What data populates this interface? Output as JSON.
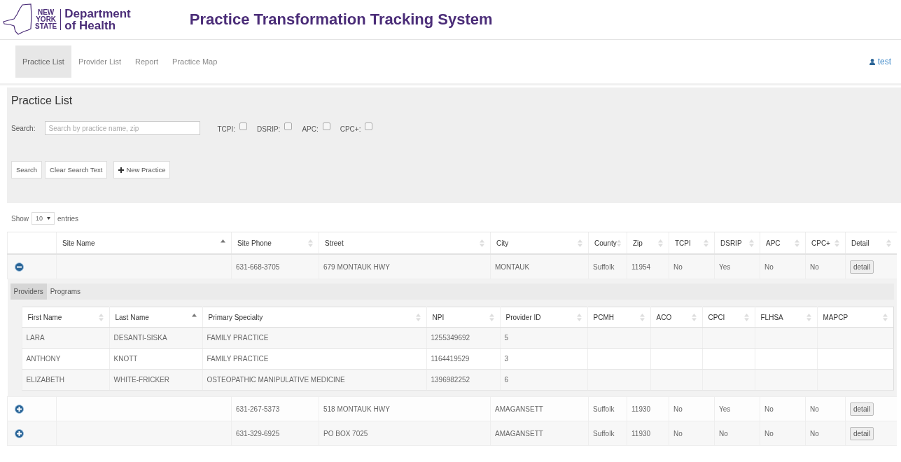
{
  "header": {
    "logo_lines": [
      "NEW",
      "YORK",
      "STATE"
    ],
    "department_lines": [
      "Department",
      "of Health"
    ],
    "title": "Practice Transformation Tracking System"
  },
  "nav": {
    "items": [
      {
        "label": "Practice List",
        "selected": true
      },
      {
        "label": "Provider List",
        "selected": false
      },
      {
        "label": "Report",
        "selected": false
      },
      {
        "label": "Practice Map",
        "selected": false
      }
    ],
    "user": "test"
  },
  "search_panel": {
    "title": "Practice List",
    "search_label": "Search:",
    "placeholder": "Search by practice name, zip",
    "filters": [
      {
        "label": "TCPI:",
        "checked": false
      },
      {
        "label": "DSRIP:",
        "checked": false
      },
      {
        "label": "APC:",
        "checked": false
      },
      {
        "label": "CPC+:",
        "checked": false
      }
    ],
    "buttons": [
      {
        "label": "Search",
        "kind": "plain"
      },
      {
        "label": "Clear Search Text",
        "kind": "plain"
      },
      {
        "label": "New Practice",
        "kind": "add"
      }
    ]
  },
  "entries": {
    "show": "Show",
    "value": "10",
    "suffix": "entries"
  },
  "table": {
    "columns": [
      {
        "label": "Site Name",
        "sorted": true
      },
      {
        "label": "Site Phone",
        "sorted": false
      },
      {
        "label": "Street",
        "sorted": false
      },
      {
        "label": "City",
        "sorted": false
      },
      {
        "label": "County",
        "sorted": false
      },
      {
        "label": "Zip",
        "sorted": false
      },
      {
        "label": "TCPI",
        "sorted": false
      },
      {
        "label": "DSRIP",
        "sorted": false
      },
      {
        "label": "APC",
        "sorted": false
      },
      {
        "label": "CPC+",
        "sorted": false
      },
      {
        "label": "Detail",
        "sorted": false
      }
    ],
    "rows": [
      {
        "expanded": true,
        "cells": [
          "",
          "631-668-3705",
          "679 MONTAUK HWY",
          "MONTAUK",
          "Suffolk",
          "11954",
          "No",
          "Yes",
          "No",
          "No"
        ],
        "detail": "detail",
        "child": {
          "tabs": [
            {
              "label": "Providers",
              "selected": true
            },
            {
              "label": "Programs",
              "selected": false
            }
          ],
          "columns": [
            {
              "label": "First Name",
              "sorted": false
            },
            {
              "label": "Last Name",
              "sorted": true
            },
            {
              "label": "Primary Specialty",
              "sorted": false
            },
            {
              "label": "NPI",
              "sorted": false
            },
            {
              "label": "Provider ID",
              "sorted": false
            },
            {
              "label": "PCMH",
              "sorted": false
            },
            {
              "label": "ACO",
              "sorted": false
            },
            {
              "label": "CPCI",
              "sorted": false
            },
            {
              "label": "FLHSA",
              "sorted": false
            },
            {
              "label": "MAPCP",
              "sorted": false
            }
          ],
          "rows": [
            [
              "LARA",
              "DESANTI-SISKA",
              "FAMILY PRACTICE",
              "1255349692",
              "5",
              "",
              "",
              "",
              "",
              ""
            ],
            [
              "ANTHONY",
              "KNOTT",
              "FAMILY PRACTICE",
              "1164419529",
              "3",
              "",
              "",
              "",
              "",
              ""
            ],
            [
              "ELIZABETH",
              "WHITE-FRICKER",
              "OSTEOPATHIC MANIPULATIVE MEDICINE",
              "1396982252",
              "6",
              "",
              "",
              "",
              "",
              ""
            ]
          ]
        }
      },
      {
        "expanded": false,
        "cells": [
          "",
          "631-267-5373",
          "518 MONTAUK HWY",
          "AMAGANSETT",
          "Suffolk",
          "11930",
          "No",
          "Yes",
          "No",
          "No"
        ],
        "detail": "detail"
      },
      {
        "expanded": false,
        "cells": [
          "",
          "631-329-6925",
          "PO BOX 7025",
          "AMAGANSETT",
          "Suffolk",
          "11930",
          "No",
          "No",
          "No",
          "No"
        ],
        "detail": "detail"
      }
    ]
  }
}
